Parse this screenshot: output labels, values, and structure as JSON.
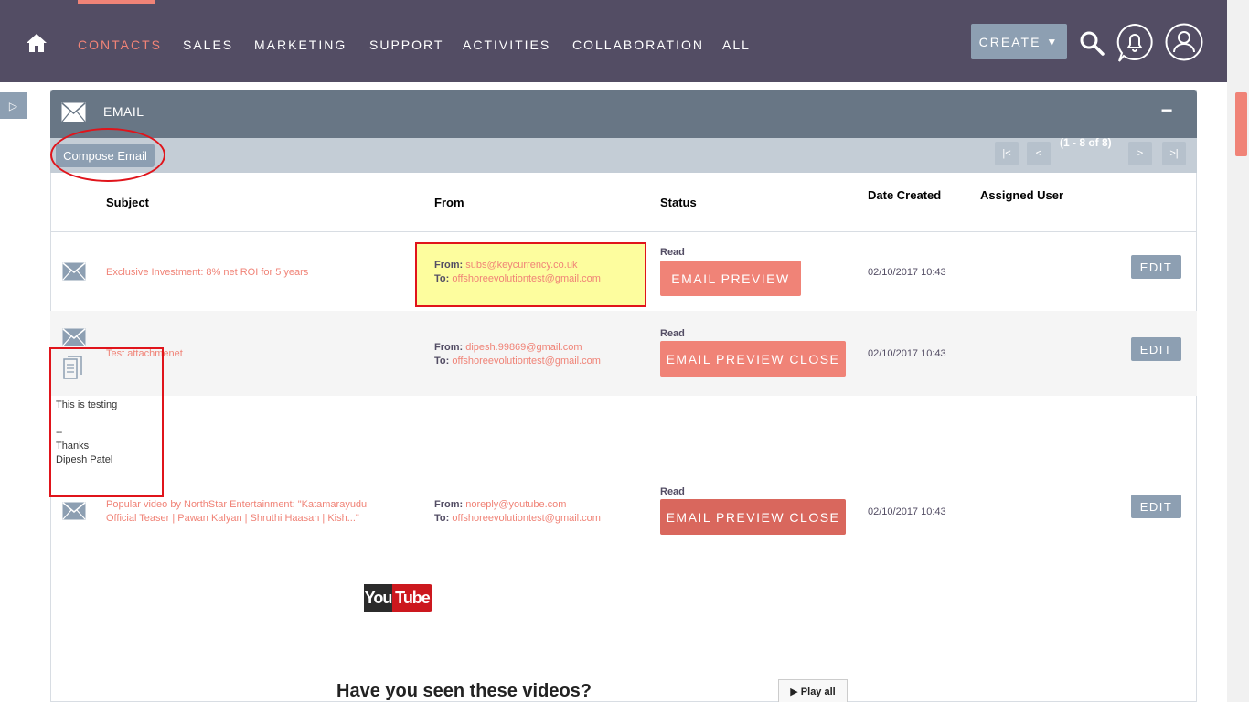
{
  "nav": {
    "items": [
      "CONTACTS",
      "SALES",
      "MARKETING",
      "SUPPORT",
      "ACTIVITIES",
      "COLLABORATION",
      "ALL"
    ],
    "create_label": "CREATE",
    "create_caret": "▼",
    "icons": [
      "home-icon",
      "search-icon",
      "bell-icon",
      "user-icon"
    ],
    "accent_color": "#f08377",
    "bar_color": "#534d64"
  },
  "side_toggle": "▷",
  "panel": {
    "title": "EMAIL",
    "collapse_label": "−",
    "compose_label": "Compose Email",
    "pagination": {
      "first": "|<",
      "prev": "<",
      "info": "(1 - 8 of 8)",
      "next": ">",
      "last": ">|"
    },
    "columns": [
      "Subject",
      "From",
      "Status",
      "Date Created",
      "Assigned User"
    ]
  },
  "rows": [
    {
      "subject": "Exclusive Investment: 8% net ROI for 5 years",
      "from_label": "From:",
      "from": "subs@keycurrency.co.uk",
      "to_label": "To:",
      "to": "offshoreevolutiontest@gmail.com",
      "status": "Read",
      "preview_label": "EMAIL PREVIEW",
      "date": "02/10/2017 10:43",
      "edit_label": "EDIT"
    },
    {
      "subject": "Test attachmenet",
      "from_label": "From:",
      "from": "dipesh.99869@gmail.com",
      "to_label": "To:",
      "to": "offshoreevolutiontest@gmail.com",
      "status": "Read",
      "preview_label": "EMAIL PREVIEW CLOSE",
      "date": "02/10/2017 10:43",
      "edit_label": "EDIT",
      "body_lines": [
        "This is testing",
        "--",
        "Thanks",
        "Dipesh Patel"
      ]
    },
    {
      "subject_line1": "Popular video by NorthStar Entertainment: \"Katamarayudu",
      "subject_line2": "Official Teaser | Pawan Kalyan | Shruthi Haasan | Kish...\"",
      "from_label": "From:",
      "from": "noreply@youtube.com",
      "to_label": "To:",
      "to": "offshoreevolutiontest@gmail.com",
      "status": "Read",
      "preview_label": "EMAIL PREVIEW CLOSE",
      "date": "02/10/2017 10:43",
      "edit_label": "EDIT"
    }
  ],
  "youtube": {
    "logo_you": "You",
    "logo_tube": "Tube",
    "heading": "Have you seen these videos?",
    "play_all": "▶ Play all"
  }
}
